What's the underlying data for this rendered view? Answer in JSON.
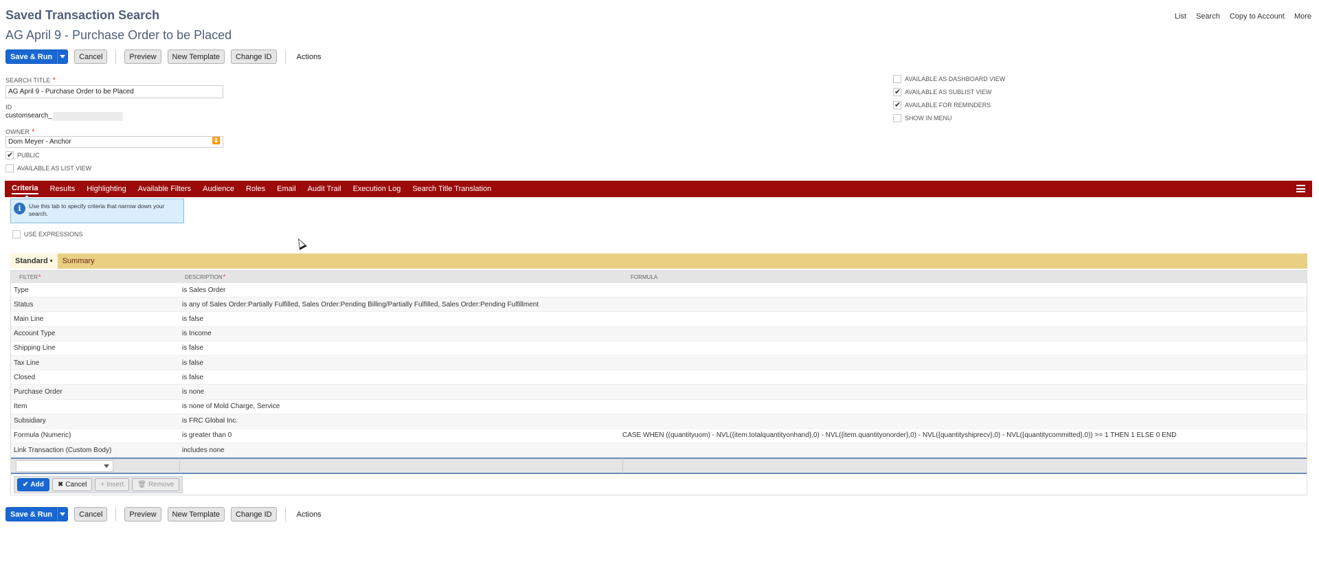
{
  "header": {
    "page_title": "Saved Transaction Search",
    "record_title": "AG April 9 - Purchase Order to be Placed"
  },
  "top_nav": {
    "list": "List",
    "search": "Search",
    "copy": "Copy to Account",
    "more": "More"
  },
  "toolbar": {
    "save_run": "Save & Run",
    "cancel": "Cancel",
    "preview": "Preview",
    "new_template": "New Template",
    "change_id": "Change ID",
    "actions": "Actions"
  },
  "form": {
    "search_title_label": "SEARCH TITLE",
    "search_title_value": "AG April 9 - Purchase Order to be Placed",
    "id_label": "ID",
    "id_value": "customsearch_",
    "owner_label": "OWNER",
    "owner_value": "Dom Meyer - Anchor",
    "public_label": "PUBLIC",
    "public_checked": true,
    "list_view_label": "AVAILABLE AS LIST VIEW",
    "list_view_checked": false
  },
  "options": {
    "dashboard_label": "AVAILABLE AS DASHBOARD VIEW",
    "dashboard_checked": false,
    "sublist_label": "AVAILABLE AS SUBLIST VIEW",
    "sublist_checked": true,
    "reminders_label": "AVAILABLE FOR REMINDERS",
    "reminders_checked": true,
    "menu_label": "SHOW IN MENU",
    "menu_checked": false
  },
  "tabs": [
    {
      "label": "Criteria"
    },
    {
      "label": "Results"
    },
    {
      "label": "Highlighting"
    },
    {
      "label": "Available Filters"
    },
    {
      "label": "Audience"
    },
    {
      "label": "Roles"
    },
    {
      "label": "Email"
    },
    {
      "label": "Audit Trail"
    },
    {
      "label": "Execution Log"
    },
    {
      "label": "Search Title Translation"
    }
  ],
  "help": {
    "text": "Use this tab to specify criteria that narrow down your search."
  },
  "use_expressions_label": "USE EXPRESSIONS",
  "subtabs": [
    {
      "label": "Standard •"
    },
    {
      "label": "Summary"
    }
  ],
  "grid": {
    "headers": [
      "FILTER",
      "DESCRIPTION",
      "FORMULA"
    ],
    "rows": [
      {
        "filter": "Type",
        "description": "is Sales Order",
        "formula": ""
      },
      {
        "filter": "Status",
        "description": "is any of Sales Order:Partially Fulfilled, Sales Order:Pending Billing/Partially Fulfilled, Sales Order:Pending Fulfillment",
        "formula": ""
      },
      {
        "filter": "Main Line",
        "description": "is false",
        "formula": ""
      },
      {
        "filter": "Account Type",
        "description": "is Income",
        "formula": ""
      },
      {
        "filter": "Shipping Line",
        "description": "is false",
        "formula": ""
      },
      {
        "filter": "Tax Line",
        "description": "is false",
        "formula": ""
      },
      {
        "filter": "Closed",
        "description": "is false",
        "formula": ""
      },
      {
        "filter": "Purchase Order",
        "description": "is none",
        "formula": ""
      },
      {
        "filter": "Item",
        "description": "is none of Mold Charge, Service",
        "formula": ""
      },
      {
        "filter": "Subsidiary",
        "description": "is FRC Global Inc.",
        "formula": ""
      },
      {
        "filter": "Formula (Numeric)",
        "description": "is greater than 0",
        "formula": "CASE WHEN ((quantityuom) - NVL({item.totalquantityonhand},0) - NVL({item.quantityonorder},0) - NVL({quantityshiprecv},0) - NVL({quantitycommitted},0)) >= 1 THEN 1 ELSE 0 END"
      },
      {
        "filter": "Link Transaction (Custom Body)",
        "description": "includes none",
        "formula": ""
      }
    ]
  },
  "row_actions": {
    "add": "Add",
    "cancel": "Cancel",
    "insert": "Insert",
    "remove": "Remove"
  }
}
